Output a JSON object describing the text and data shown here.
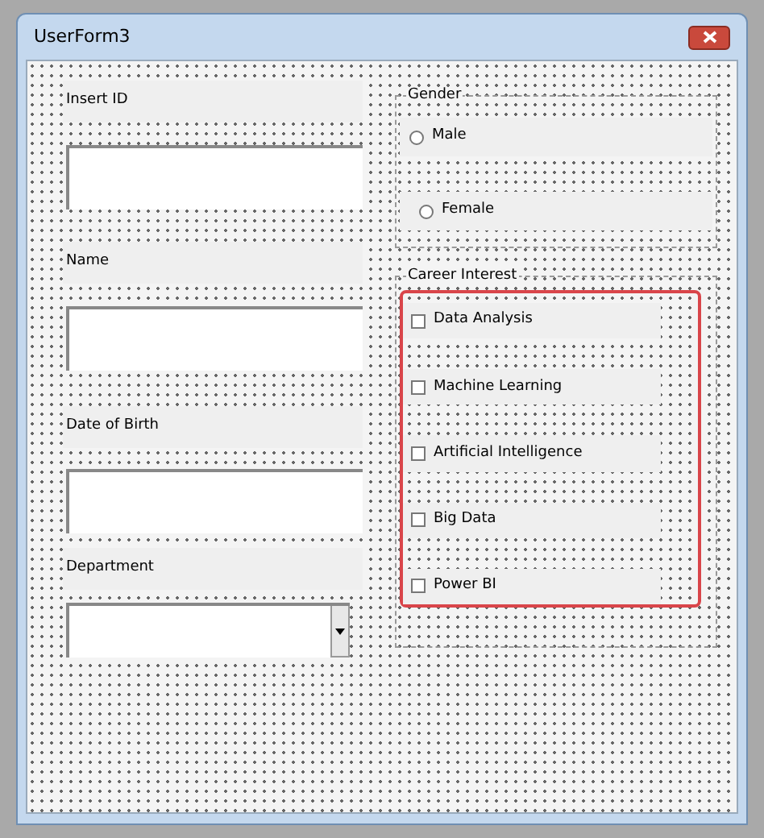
{
  "window": {
    "title": "UserForm3"
  },
  "fields": [
    {
      "kind": "textbox",
      "label": "Insert ID"
    },
    {
      "kind": "textbox",
      "label": "Name"
    },
    {
      "kind": "textbox",
      "label": "Date of Birth"
    },
    {
      "kind": "combobox",
      "label": "Department"
    }
  ],
  "gender": {
    "caption": "Gender",
    "options": [
      {
        "label": "Male",
        "selected": false
      },
      {
        "label": "Female",
        "selected": false
      }
    ]
  },
  "career_interest": {
    "caption": "Career Interest",
    "highlighted": true,
    "options": [
      {
        "label": "Data Analysis",
        "checked": false
      },
      {
        "label": "Machine Learning",
        "checked": false
      },
      {
        "label": "Artificial Intelligence",
        "checked": false
      },
      {
        "label": "Big Data",
        "checked": false
      },
      {
        "label": "Power BI",
        "checked": false
      }
    ]
  }
}
